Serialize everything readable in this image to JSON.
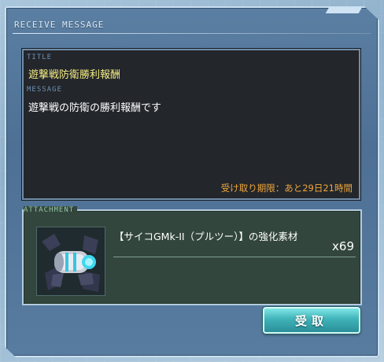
{
  "window": {
    "title": "RECEIVE MESSAGE"
  },
  "message": {
    "title_label": "TITLE",
    "title": "遊撃戦防衛勝利報酬",
    "message_label": "MESSAGE",
    "body": "遊撃戦の防衛の勝利報酬です",
    "deadline": "受け取り期限：あと29日21時間"
  },
  "attachment": {
    "label": "ATTACHMENT",
    "item_name": "【サイコGMk-II（プルツー）】の強化素材",
    "quantity": "x69",
    "item_icon": "mobile-suit-parts-icon"
  },
  "actions": {
    "receive_label": "受取"
  },
  "colors": {
    "title_text": "#f4ec83",
    "deadline_text": "#f0a63a",
    "button": "#3fb3b8"
  }
}
